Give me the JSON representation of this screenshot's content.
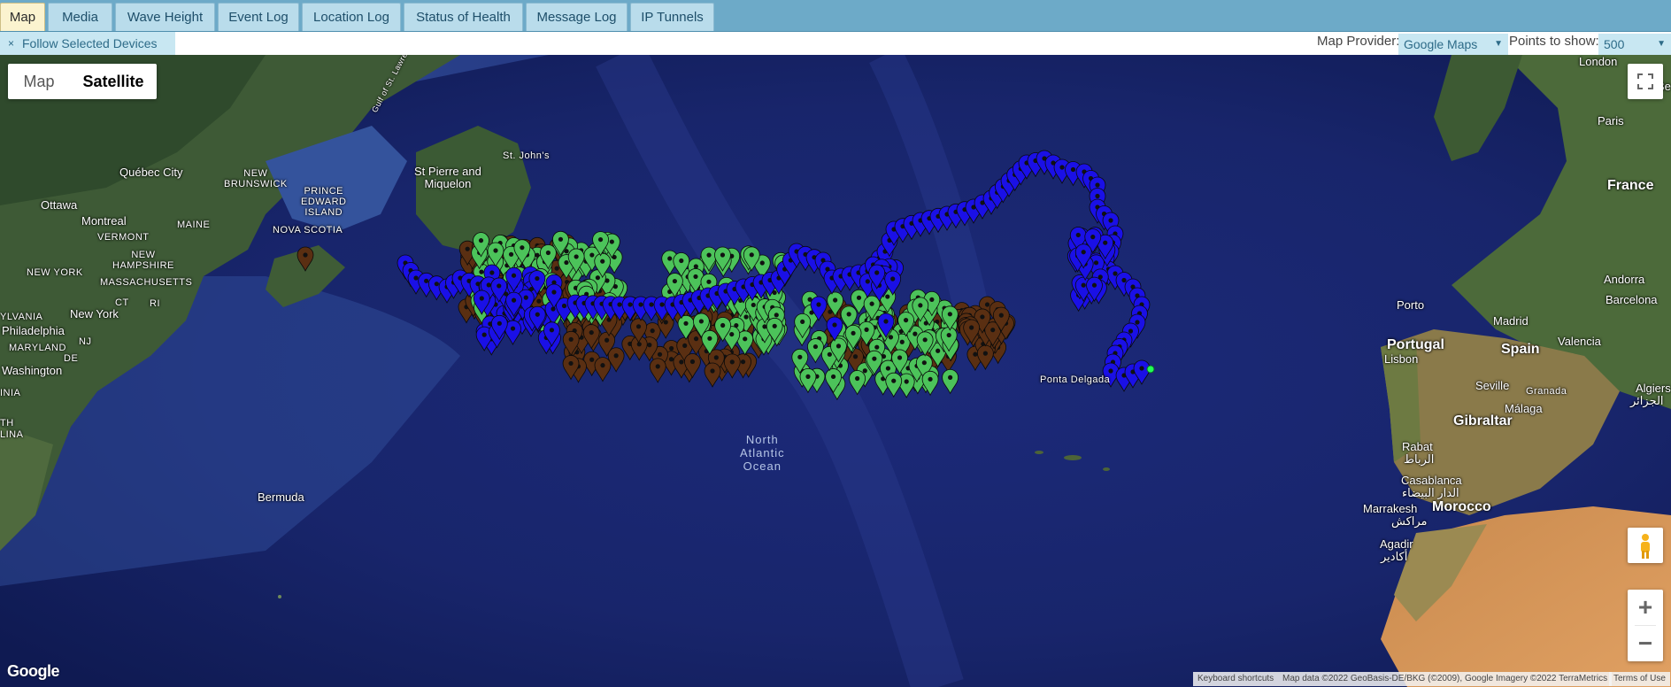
{
  "tabs": [
    {
      "label": "Map",
      "active": true
    },
    {
      "label": "Media",
      "active": false
    },
    {
      "label": "Wave Height",
      "active": false
    },
    {
      "label": "Event Log",
      "active": false
    },
    {
      "label": "Location Log",
      "active": false
    },
    {
      "label": "Status of Health",
      "active": false
    },
    {
      "label": "Message Log",
      "active": false
    },
    {
      "label": "IP Tunnels",
      "active": false
    }
  ],
  "toolbar": {
    "follow_icon": "×",
    "follow_label": "Follow Selected Devices",
    "provider_label": "Map Provider:",
    "provider_value": "Google Maps",
    "points_label": "Points to show:",
    "points_value": "500"
  },
  "map": {
    "map_type_buttons": [
      "Map",
      "Satellite"
    ],
    "selected_map_type": "Satellite",
    "zoom_in": "+",
    "zoom_out": "−",
    "logo": "Google",
    "attribution": {
      "shortcuts": "Keyboard shortcuts",
      "data": "Map data ©2022 GeoBasis-DE/BKG (©2009), Google Imagery ©2022 TerraMetrics",
      "terms": "Terms of Use"
    },
    "labels": {
      "london": "London",
      "be": "Be",
      "paris": "Paris",
      "france": "France",
      "andorra": "Andorra",
      "barcelona": "Barcelona",
      "porto": "Porto",
      "madrid": "Madrid",
      "portugal": "Portugal",
      "spain": "Spain",
      "valencia": "Valencia",
      "lisbon": "Lisbon",
      "seville": "Seville",
      "granada": "Granada",
      "algiers": "Algiers",
      "algiers_ar": "الجزائر",
      "malaga": "Málaga",
      "gibraltar": "Gibraltar",
      "rabat": "Rabat",
      "rabat_ar": "الرباط",
      "casablanca": "Casablanca",
      "casablanca_ar": "الدار البيضاء",
      "marrakesh": "Marrakesh",
      "marrakesh_ar": "مراكش",
      "morocco": "Morocco",
      "agadir": "Agadir",
      "agadir_ar": "أكادير",
      "quebec": "Québec City",
      "ottawa": "Ottawa",
      "montreal": "Montreal",
      "new_brunswick": "NEW\nBRUNSWICK",
      "maine": "MAINE",
      "vermont": "VERMONT",
      "pei": "PRINCE\nEDWARD\nISLAND",
      "nova_scotia": "NOVA SCOTIA",
      "new_york_state": "NEW YORK",
      "new_hampshire": "NEW\nHAMPSHIRE",
      "massachusetts": "MASSACHUSETTS",
      "ct": "CT",
      "ri": "RI",
      "pennsylvania": "YLVANIA",
      "new_york": "New York",
      "philadelphia": "Philadelphia",
      "nj": "NJ",
      "maryland": "MARYLAND",
      "de": "DE",
      "washington": "Washington",
      "inia": "INIA",
      "lina": "LINA",
      "th": "TH",
      "gulf": "Gulf of St. Lawrence",
      "st_johns": "St. John's",
      "st_pierre": "St Pierre and\nMiquelon",
      "bermuda": "Bermuda",
      "ponta_delgada": "Ponta Delgada",
      "ocean": "North\nAtlantic\nOcean"
    },
    "marker_colors": {
      "blue": "#1a10e6",
      "green": "#4cc35a",
      "brown": "#5a2f12",
      "active": "#22ff55"
    },
    "tracks": {
      "blue": [
        [
          3,
          10
        ],
        [
          2,
          8
        ],
        [
          1,
          6
        ],
        [
          0,
          5
        ],
        [
          -1,
          4
        ],
        [
          -2,
          3
        ],
        [
          -3,
          2
        ],
        [
          -4,
          1
        ],
        [
          -5,
          0
        ],
        [
          -6,
          -1
        ],
        [
          -7,
          -2
        ],
        [
          -8,
          -2
        ],
        [
          -9,
          -2
        ],
        [
          -10,
          -3
        ],
        [
          -11,
          -4
        ],
        [
          -12,
          -5
        ],
        [
          -13,
          -6
        ],
        [
          -13,
          -7
        ],
        [
          -14,
          -8
        ],
        [
          -15,
          -9
        ],
        [
          -16,
          -10
        ],
        [
          -17,
          -11
        ],
        [
          -17,
          -12
        ],
        [
          -18,
          -13
        ],
        [
          -19,
          -14
        ],
        [
          -20,
          -15
        ],
        [
          -21,
          -15
        ],
        [
          -22,
          -16
        ],
        [
          -23,
          -17
        ],
        [
          -24,
          -18
        ],
        [
          -25,
          -19
        ],
        [
          -26,
          -20
        ],
        [
          -27,
          -21
        ],
        [
          -28,
          -22
        ],
        [
          -29,
          -22
        ],
        [
          -30,
          -23
        ],
        [
          -30,
          -24
        ],
        [
          -31,
          -25
        ],
        [
          -31,
          -26
        ],
        [
          -32,
          -27
        ],
        [
          -32,
          -28
        ],
        [
          -33,
          -29
        ],
        [
          -33,
          -30
        ],
        [
          -34,
          -31
        ],
        [
          -34,
          -32
        ],
        [
          -35,
          -33
        ],
        [
          -35,
          -34
        ],
        [
          -36,
          -35
        ],
        [
          -36,
          -36
        ],
        [
          -37,
          -37
        ],
        [
          -38,
          -38
        ],
        [
          -38,
          -39
        ],
        [
          -39,
          -40
        ],
        [
          -39,
          -41
        ],
        [
          -40,
          -42
        ],
        [
          -41,
          -43
        ],
        [
          -41,
          -44
        ],
        [
          -42,
          -45
        ],
        [
          -43,
          -46
        ],
        [
          -44,
          -47
        ],
        [
          -45,
          -48
        ],
        [
          -46,
          -49
        ],
        [
          -47,
          -50
        ]
      ]
    }
  }
}
